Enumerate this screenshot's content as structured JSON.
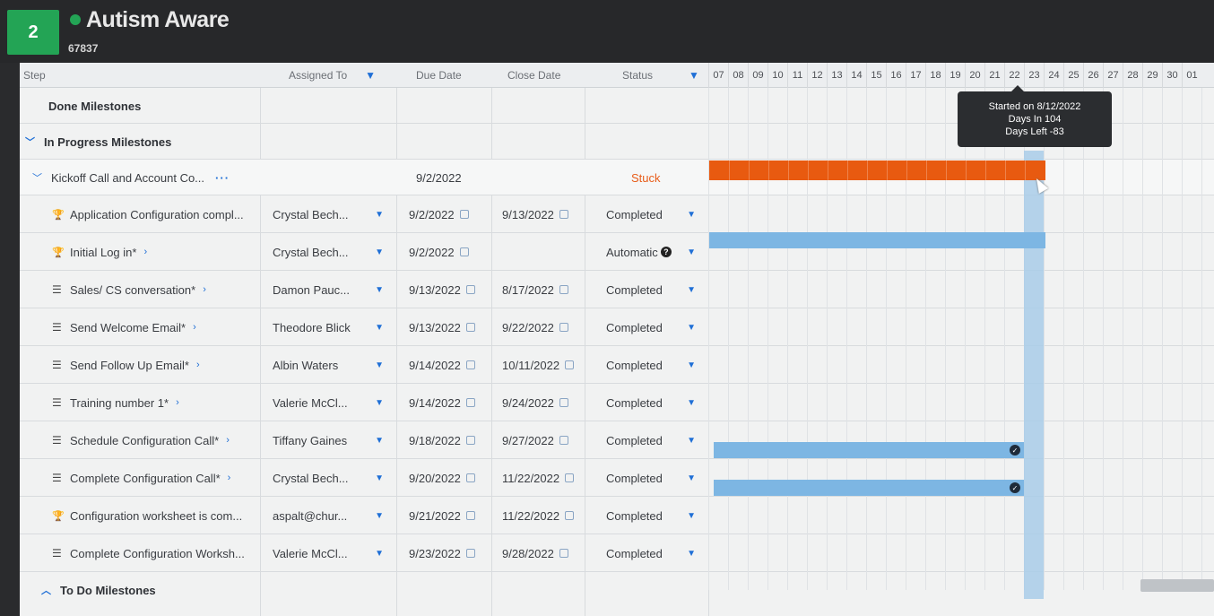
{
  "project": {
    "number": "2",
    "title": "Autism Aware",
    "id": "67837",
    "status_color": "#23a455"
  },
  "columns": {
    "step": "Step",
    "assigned_to": "Assigned To",
    "due_date": "Due Date",
    "close_date": "Close Date",
    "status": "Status"
  },
  "timeline_days": [
    "07",
    "08",
    "09",
    "10",
    "11",
    "12",
    "13",
    "14",
    "15",
    "16",
    "17",
    "18",
    "19",
    "20",
    "21",
    "22",
    "23",
    "24",
    "25",
    "26",
    "27",
    "28",
    "29",
    "30",
    "01"
  ],
  "sections": {
    "done": "Done Milestones",
    "in_progress": "In Progress Milestones",
    "todo": "To Do Milestones"
  },
  "milestone": {
    "name": "Kickoff Call and Account Co...",
    "due": "9/2/2022",
    "status": "Stuck"
  },
  "tasks": [
    {
      "icon": "trophy-icon",
      "name": "Application Configuration compl...",
      "assignee": "Crystal Bech...",
      "due": "9/2/2022",
      "close": "9/13/2022",
      "status": "Completed",
      "chevron": false
    },
    {
      "icon": "trophy-icon",
      "name": "Initial Log in*",
      "assignee": "Crystal Bech...",
      "due": "9/2/2022",
      "close": "",
      "status": "Automatic",
      "chevron": true
    },
    {
      "icon": "list-icon",
      "name": "Sales/ CS conversation*",
      "assignee": "Damon Pauc...",
      "due": "9/13/2022",
      "close": "8/17/2022",
      "status": "Completed",
      "chevron": true
    },
    {
      "icon": "list-icon",
      "name": "Send Welcome Email*",
      "assignee": "Theodore Blick",
      "due": "9/13/2022",
      "close": "9/22/2022",
      "status": "Completed",
      "chevron": true
    },
    {
      "icon": "list-icon",
      "name": "Send Follow Up Email*",
      "assignee": "Albin Waters",
      "due": "9/14/2022",
      "close": "10/11/2022",
      "status": "Completed",
      "chevron": true
    },
    {
      "icon": "list-icon",
      "name": "Training number 1*",
      "assignee": "Valerie McCl...",
      "due": "9/14/2022",
      "close": "9/24/2022",
      "status": "Completed",
      "chevron": true
    },
    {
      "icon": "list-icon",
      "name": "Schedule Configuration Call*",
      "assignee": "Tiffany Gaines",
      "due": "9/18/2022",
      "close": "9/27/2022",
      "status": "Completed",
      "chevron": true
    },
    {
      "icon": "list-icon",
      "name": "Complete Configuration Call*",
      "assignee": "Crystal Bech...",
      "due": "9/20/2022",
      "close": "11/22/2022",
      "status": "Completed",
      "chevron": true
    },
    {
      "icon": "trophy-icon",
      "name": "Configuration worksheet is com...",
      "assignee": "aspalt@chur...",
      "due": "9/21/2022",
      "close": "11/22/2022",
      "status": "Completed",
      "chevron": false
    },
    {
      "icon": "list-icon",
      "name": "Complete Configuration Worksh...",
      "assignee": "Valerie McCl...",
      "due": "9/23/2022",
      "close": "9/28/2022",
      "status": "Completed",
      "chevron": false
    }
  ],
  "tooltip": {
    "line1": "Started on 8/12/2022",
    "line2": "Days In 104",
    "line3": "Days Left -83"
  },
  "colors": {
    "stuck": "#e85a10",
    "bar": "#7db6e3",
    "today": "#a9cce9",
    "accent": "#1f6fd6"
  }
}
